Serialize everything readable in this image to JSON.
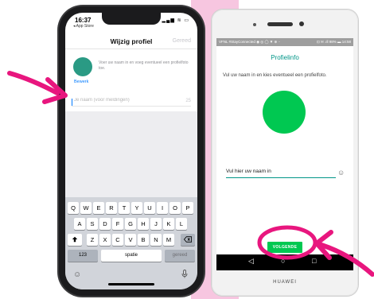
{
  "ios": {
    "status_time": "16:37",
    "status_back_app": "◂ App Store",
    "status_indicators": "▂▄▆ ≋ ▭",
    "nav_title": "Wijzig profiel",
    "nav_done": "Gereed",
    "profile_info_text": "Voer uw naam in en voeg eventueel een profielfoto toe.",
    "edit_label": "Bewerk",
    "name_placeholder": "Je naam (voor meldingen)",
    "name_value": "",
    "char_counter": "25",
    "keyboard": {
      "row1": [
        "Q",
        "W",
        "E",
        "R",
        "T",
        "Y",
        "U",
        "I",
        "O",
        "P"
      ],
      "row2": [
        "A",
        "S",
        "D",
        "F",
        "G",
        "H",
        "J",
        "K",
        "L"
      ],
      "row3": [
        "Z",
        "X",
        "C",
        "V",
        "B",
        "N",
        "M"
      ],
      "shift_icon": "shift-icon",
      "delete_icon": "backspace-icon",
      "numbers_label": "123",
      "space_label": "spatie",
      "return_label": "gereed",
      "emoji_icon": "emoji-icon",
      "mic_icon": "microphone-icon"
    }
  },
  "android": {
    "status_left": "VFNL #StayConnected ◉ ◎ ◯ ▼ ⊕ ··",
    "status_right": "⊡ ✉ .ıll 98% ▬ 14:58",
    "title": "Profielinfo",
    "description": "Vul uw naam in en kies eventueel een profielfoto.",
    "name_placeholder": "Vul hier uw naam in",
    "name_value": "",
    "emoji_icon": "emoji-icon",
    "next_button": "VOLGENDE",
    "nav_back": "◁",
    "nav_home": "○",
    "nav_recent": "□",
    "brand": "HUAWEI"
  },
  "colors": {
    "accent_pink": "#e8167e",
    "android_green": "#00c851",
    "android_teal": "#009688",
    "ios_avatar": "#2a9a84",
    "ios_blue": "#007aff",
    "background_pink": "#f7c6e0"
  }
}
